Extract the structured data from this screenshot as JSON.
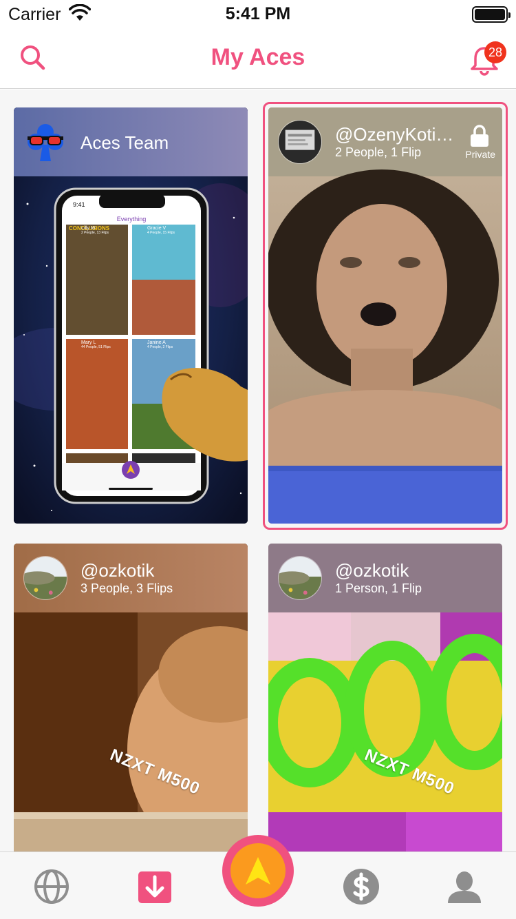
{
  "status_bar": {
    "carrier": "Carrier",
    "time": "5:41 PM"
  },
  "nav": {
    "title": "My Aces",
    "notification_count": "28"
  },
  "cards": [
    {
      "title": "Aces Team",
      "subtitle": ""
    },
    {
      "title": "@OzenyKoti…",
      "subtitle": "2 People, 1 Flip",
      "privacy_label": "Private",
      "selected": true
    },
    {
      "title": "@ozkotik",
      "subtitle": "3 People, 3 Flips",
      "overlay_text": "NZXT M500"
    },
    {
      "title": "@ozkotik",
      "subtitle": "1 Person, 1 Flip",
      "overlay_text": "NZXT M500"
    }
  ],
  "phone_preview": {
    "time": "9:41",
    "header": "Everything",
    "banner": "CONCLUSIONS",
    "tiles": [
      {
        "name": "Lilly W",
        "meta": "2 People, 13 Flips"
      },
      {
        "name": "Gracie V",
        "meta": "4 People, 15 Flips"
      },
      {
        "name": "Mary L",
        "meta": "44 People, 51 Flips"
      },
      {
        "name": "Janine A",
        "meta": "4 People, 2 Flips"
      }
    ]
  },
  "tab_bar": {
    "items": [
      "globe-icon",
      "inbox-download-icon",
      "aces-icon",
      "dollar-icon",
      "profile-icon"
    ],
    "active": "inbox-download-icon"
  },
  "colors": {
    "accent": "#f0517f",
    "badge": "#f0331d",
    "center_inner": "#fb9a1e",
    "tab_inactive": "#8e8e8e"
  }
}
